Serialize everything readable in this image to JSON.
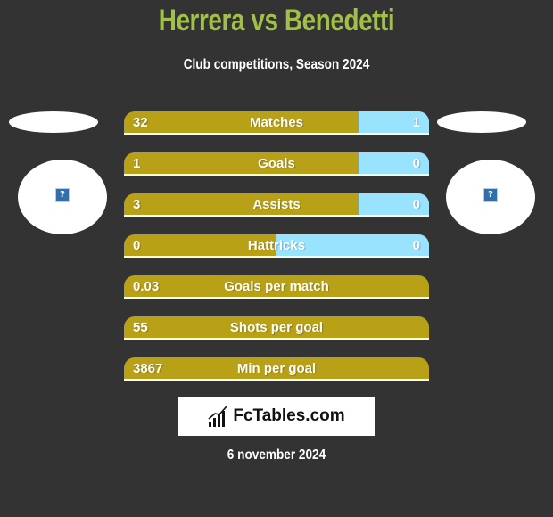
{
  "header": {
    "title": "Herrera vs Benedetti",
    "subtitle": "Club competitions, Season 2024"
  },
  "players": {
    "left": {
      "name": "Herrera",
      "photo_icon": "image-placeholder-icon"
    },
    "right": {
      "name": "Benedetti",
      "photo_icon": "image-placeholder-icon"
    }
  },
  "colors": {
    "title": "#a0c047",
    "left_bar": "#b8a117",
    "right_bar": "#99e3ff",
    "background": "#333333"
  },
  "stats": [
    {
      "label": "Matches",
      "left": "32",
      "right": "1",
      "right_share": 0.23
    },
    {
      "label": "Goals",
      "left": "1",
      "right": "0",
      "right_share": 0.23
    },
    {
      "label": "Assists",
      "left": "3",
      "right": "0",
      "right_share": 0.23
    },
    {
      "label": "Hattricks",
      "left": "0",
      "right": "0",
      "right_share": 0.5
    },
    {
      "label": "Goals per match",
      "left": "0.03",
      "right": "",
      "right_share": 0
    },
    {
      "label": "Shots per goal",
      "left": "55",
      "right": "",
      "right_share": 0
    },
    {
      "label": "Min per goal",
      "left": "3867",
      "right": "",
      "right_share": 0
    }
  ],
  "footer": {
    "logo_text": "FcTables.com",
    "date": "6 november 2024"
  }
}
